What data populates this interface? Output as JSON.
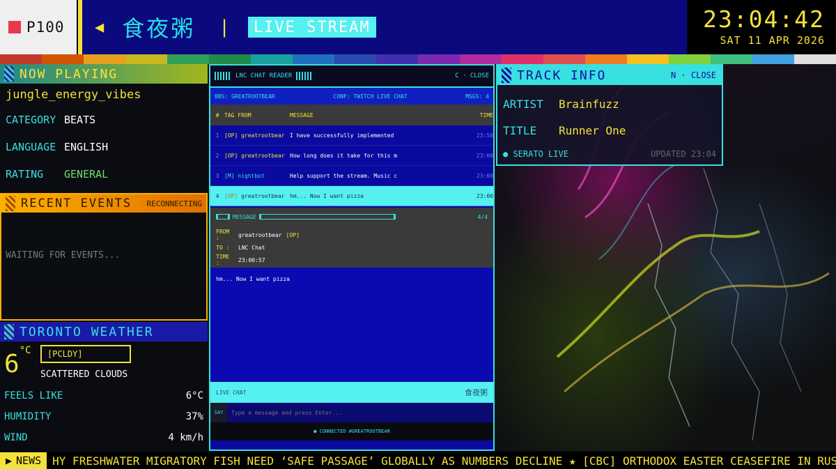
{
  "topbar": {
    "channel": "P100",
    "brand": "食夜粥",
    "mode": "LIVE STREAM",
    "time": "23:04:42",
    "date": "SAT 11 APR 2026"
  },
  "colors": [
    "#c0392b",
    "#d35400",
    "#e6a020",
    "#c8b820",
    "#2ea05a",
    "#1f8a4a",
    "#1aa0a0",
    "#2070c0",
    "#2a4ab0",
    "#4030b0",
    "#7a2ab0",
    "#b02aa0",
    "#e0306a",
    "#e05050",
    "#f07a20",
    "#f3c020",
    "#80d040",
    "#40c080",
    "#40a0e0",
    "#e0e0e0"
  ],
  "now_playing": {
    "header": "NOW PLAYING",
    "title": "jungle_energy_vibes",
    "rows": [
      {
        "k": "CATEGORY",
        "v": "BEATS"
      },
      {
        "k": "LANGUAGE",
        "v": "ENGLISH"
      },
      {
        "k": "RATING",
        "v": "GENERAL"
      }
    ]
  },
  "recent": {
    "header": "RECENT EVENTS",
    "status": "RECONNECTING",
    "empty": "WAITING FOR EVENTS..."
  },
  "weather": {
    "header": "TORONTO WEATHER",
    "temp": "6",
    "unit": "°C",
    "code": "[PCLDY]",
    "condition": "SCATTERED CLOUDS",
    "rows": [
      {
        "k": "FEELS LIKE",
        "v": "6°C"
      },
      {
        "k": "HUMIDITY",
        "v": "37%"
      },
      {
        "k": "WIND",
        "v": "4 km/h"
      }
    ]
  },
  "chat": {
    "title": "LNC CHAT READER",
    "close": "C · CLOSE",
    "bbs": "BBS: GREATROOTBEAR",
    "conf": "CONF: TWITCH LIVE CHAT",
    "msgs": "MSGS: 4",
    "columns": {
      "num": "#",
      "tag": "TAG FROM",
      "msg": "MESSAGE",
      "time": "TIME"
    },
    "rows": [
      {
        "n": "1",
        "tag": "[OP]",
        "from": "greatrootbear",
        "msg": "I have successfully implemented",
        "time": "23:58"
      },
      {
        "n": "2",
        "tag": "[OP]",
        "from": "greatrootbear",
        "msg": "How long does it take for this m",
        "time": "23:00"
      },
      {
        "n": "3",
        "tag": "[M]",
        "from": "nightbot",
        "msg": "Help support the stream. Music c",
        "time": "23:00"
      },
      {
        "n": "4",
        "tag": "[OP]",
        "from": "greatrootbear",
        "msg": "hm... Now I want pizza",
        "time": "23:00"
      }
    ],
    "message": {
      "label": "MESSAGE",
      "counter": "4/4",
      "from_k": "FROM :",
      "from": "greatrootbear",
      "from_tag": "[OP]",
      "to_k": "TO   :",
      "to": "LNC Chat",
      "time_k": "TIME :",
      "time": "23:00:57",
      "body": "hm... Now I want pizza"
    },
    "live_label": "LIVE CHAT",
    "live_brand": "食夜粥",
    "say": "SAY",
    "placeholder": "Type a message and press Enter...",
    "connected": "● CONNECTED #GREATROOTBEAR"
  },
  "track": {
    "header": "TRACK INFO",
    "close": "N · CLOSE",
    "artist_k": "ARTIST",
    "artist": "Brainfuzz",
    "title_k": "TITLE",
    "title": "Runner One",
    "source": "● SERATO LIVE",
    "updated": "UPDATED 23:04"
  },
  "ticker": {
    "label": "NEWS",
    "text": "HY FRESHWATER MIGRATORY FISH NEED ‘SAFE PASSAGE’ GLOBALLY AS NUMBERS DECLINE ★ [CBC] ORTHODOX EASTER CEASEFIRE IN RUSSIA-UKRAINE"
  }
}
